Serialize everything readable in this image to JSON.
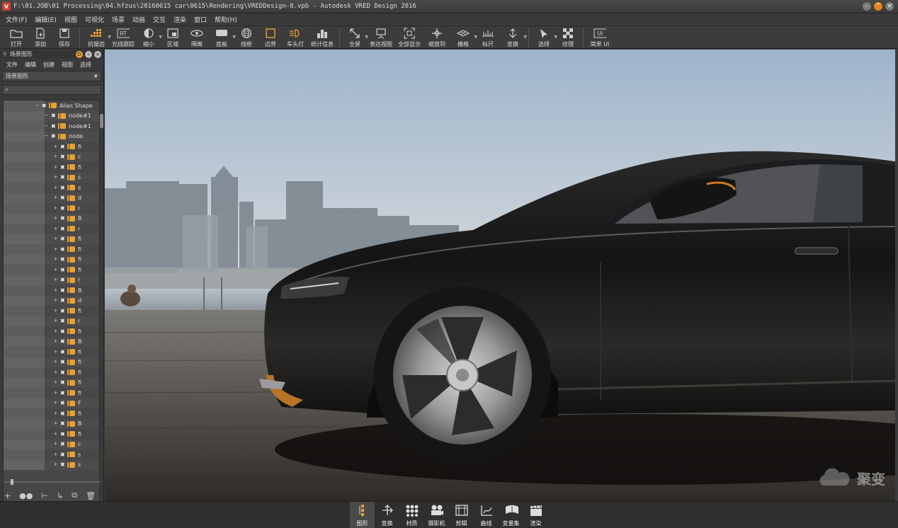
{
  "window": {
    "title": "F:\\01.JOB\\01 Processing\\04.hfzus\\20160615 car\\0615\\Rendering\\VREDDesign-8.vpb - Autodesk VRED Design 2016"
  },
  "menubar": {
    "items": [
      "文件(F)",
      "编辑(E)",
      "视图",
      "可视化",
      "场景",
      "动画",
      "交互",
      "渲染",
      "窗口",
      "帮助(H)"
    ]
  },
  "toolbar": {
    "buttons": [
      {
        "label": "打开",
        "icon": "open-folder-icon"
      },
      {
        "label": "添加",
        "icon": "add-file-icon"
      },
      {
        "label": "保存",
        "icon": "save-icon"
      },
      {
        "label": "抗锯齿",
        "icon": "antialias-icon"
      },
      {
        "label": "光线跟踪",
        "icon": "raytrace-icon"
      },
      {
        "label": "缩小",
        "icon": "shading-icon"
      },
      {
        "label": "区域",
        "icon": "region-icon"
      },
      {
        "label": "隔离",
        "icon": "isolate-icon"
      },
      {
        "label": "底板",
        "icon": "floor-icon"
      },
      {
        "label": "线框",
        "icon": "wireframe-icon"
      },
      {
        "label": "边界",
        "icon": "bounds-icon"
      },
      {
        "label": "车头灯",
        "icon": "headlight-icon"
      },
      {
        "label": "统计信息",
        "icon": "statistics-icon"
      },
      {
        "label": "全屏",
        "icon": "fullscreen-icon"
      },
      {
        "label": "表达视图",
        "icon": "presentation-view-icon"
      },
      {
        "label": "全部显示",
        "icon": "show-all-icon"
      },
      {
        "label": "缩放到",
        "icon": "zoom-to-icon"
      },
      {
        "label": "栅格",
        "icon": "grid-icon"
      },
      {
        "label": "标尺",
        "icon": "ruler-icon"
      },
      {
        "label": "变换",
        "icon": "transform-icon"
      },
      {
        "label": "选择",
        "icon": "select-icon"
      },
      {
        "label": "纹理",
        "icon": "texture-icon"
      },
      {
        "label": "简单 UI",
        "icon": "simple-ui-icon"
      }
    ]
  },
  "scenegraph": {
    "title": "场景图形",
    "menu": [
      "文件",
      "编辑",
      "创建",
      "视图",
      "选择"
    ],
    "filter_selected": "场景图形",
    "nodes": [
      {
        "label": "Alias Shape",
        "level": 0
      },
      {
        "label": "node#1",
        "level": 1
      },
      {
        "label": "node#1",
        "level": 1
      },
      {
        "label": "node",
        "level": 2
      },
      {
        "label": "fi",
        "level": 3
      },
      {
        "label": "c",
        "level": 3
      },
      {
        "label": "fi",
        "level": 3
      },
      {
        "label": "s",
        "level": 3
      },
      {
        "label": "s",
        "level": 3
      },
      {
        "label": "d",
        "level": 3
      },
      {
        "label": "r",
        "level": 3
      },
      {
        "label": "B",
        "level": 3
      },
      {
        "label": "r",
        "level": 3
      },
      {
        "label": "fi",
        "level": 3
      },
      {
        "label": "fi",
        "level": 3
      },
      {
        "label": "fi",
        "level": 3
      },
      {
        "label": "fi",
        "level": 3
      },
      {
        "label": "r",
        "level": 3
      },
      {
        "label": "B",
        "level": 3
      },
      {
        "label": "d",
        "level": 3
      },
      {
        "label": "fi",
        "level": 3
      },
      {
        "label": "r",
        "level": 3
      },
      {
        "label": "fi",
        "level": 3
      },
      {
        "label": "B",
        "level": 3
      },
      {
        "label": "fi",
        "level": 3
      },
      {
        "label": "fi",
        "level": 3
      },
      {
        "label": "fi",
        "level": 3
      },
      {
        "label": "fi",
        "level": 3
      },
      {
        "label": "fi",
        "level": 3
      },
      {
        "label": "F",
        "level": 3
      },
      {
        "label": "fi",
        "level": 3
      },
      {
        "label": "B",
        "level": 3
      },
      {
        "label": "fi",
        "level": 3
      },
      {
        "label": "c",
        "level": 3
      },
      {
        "label": "s",
        "level": 3
      },
      {
        "label": "s",
        "level": 3
      }
    ]
  },
  "modules": [
    {
      "label": "图形",
      "icon": "scenegraph-icon",
      "active": true
    },
    {
      "label": "变换",
      "icon": "transform-module-icon"
    },
    {
      "label": "材质",
      "icon": "materials-icon"
    },
    {
      "label": "摄影机",
      "icon": "camera-icon"
    },
    {
      "label": "剪辑",
      "icon": "clip-icon"
    },
    {
      "label": "曲线",
      "icon": "curves-icon"
    },
    {
      "label": "变量集",
      "icon": "variant-sets-icon"
    },
    {
      "label": "渲染",
      "icon": "render-icon"
    }
  ],
  "watermark": {
    "text": "聚变"
  },
  "colors": {
    "accent": "#e8a033",
    "maximize": "#e0861a",
    "app_icon": "#c9402f"
  }
}
